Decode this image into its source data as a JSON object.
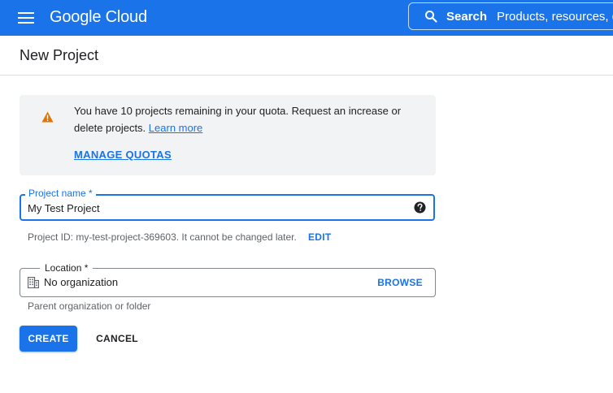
{
  "colors": {
    "brand": "#1a73e8",
    "warning": "#e37400",
    "card_bg": "#f1f3f4",
    "hint_text": "#5f6368"
  },
  "topbar": {
    "menu_icon": "hamburger-menu-icon",
    "logo_text": "Google Cloud",
    "search": {
      "icon": "search-icon",
      "label": "Search",
      "placeholder": "Products, resources, d"
    }
  },
  "page": {
    "title": "New Project"
  },
  "quota": {
    "icon": "warning-icon",
    "message": "You have 10 projects remaining in your quota. Request an increase or delete projects.",
    "learn_more": "Learn more",
    "manage_label": "MANAGE QUOTAS"
  },
  "project_name": {
    "label": "Project name *",
    "value": "My Test Project",
    "help_icon": "help-icon",
    "hint": "Project ID: my-test-project-369603. It cannot be changed later.",
    "edit_label": "EDIT"
  },
  "location": {
    "label": "Location *",
    "icon": "building-icon",
    "value": "No organization",
    "browse_label": "BROWSE",
    "hint": "Parent organization or folder"
  },
  "actions": {
    "create_label": "CREATE",
    "cancel_label": "CANCEL"
  }
}
